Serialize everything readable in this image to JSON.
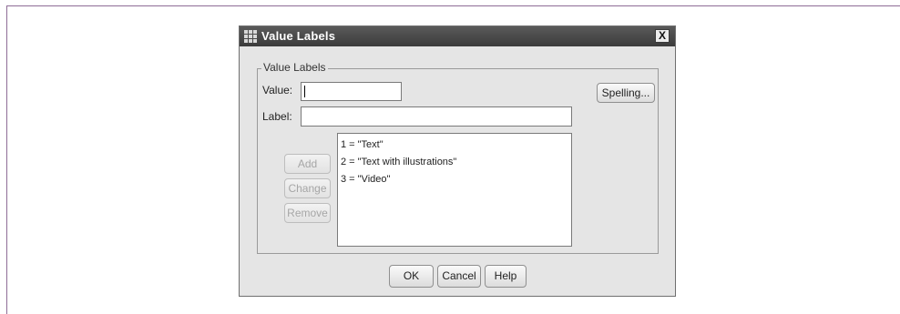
{
  "dialog": {
    "title": "Value Labels",
    "close_label": "X"
  },
  "group": {
    "legend": "Value Labels"
  },
  "fields": {
    "value_label": "Value:",
    "value_value": "",
    "label_label": "Label:",
    "label_value": ""
  },
  "buttons": {
    "spelling": "Spelling...",
    "add": "Add",
    "change": "Change",
    "remove": "Remove",
    "ok": "OK",
    "cancel": "Cancel",
    "help": "Help"
  },
  "value_labels_list": [
    "1 = \"Text\"",
    "2 = \"Text with illustrations\"",
    "3 = \"Video\""
  ],
  "colors": {
    "titlebar": "#4a4a4a",
    "dialog_bg": "#e5e5e5",
    "frame_accent": "#8e6c96"
  }
}
